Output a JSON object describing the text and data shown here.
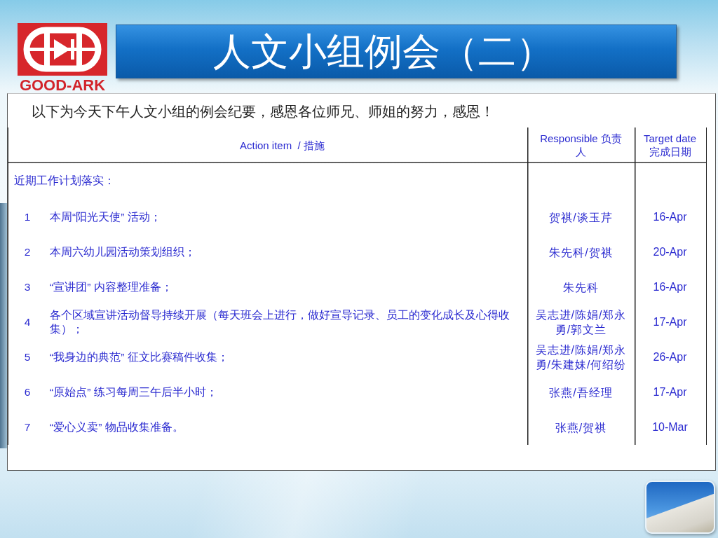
{
  "logo": {
    "wordmark": "GOOD-ARK"
  },
  "title": "人文小组例会（二）",
  "intro": "以下为今天下午人文小组的例会纪要，感恩各位师兄、师姐的努力，感恩！",
  "table": {
    "columns": [
      "Action item  / 措施",
      "Responsible 负责人",
      "Target date 完成日期"
    ],
    "section": "近期工作计划落实：",
    "rows": [
      {
        "number": "1",
        "action": "本周“阳光天使” 活动；",
        "responsible": "贺祺/谈玉芹",
        "target_date": "16-Apr"
      },
      {
        "number": "2",
        "action": "本周六幼儿园活动策划组织；",
        "responsible": "朱先科/贺祺",
        "target_date": "20-Apr"
      },
      {
        "number": "3",
        "action": "“宣讲团” 内容整理准备；",
        "responsible": "朱先科",
        "target_date": "16-Apr"
      },
      {
        "number": "4",
        "action": "各个区域宣讲活动督导持续开展（每天班会上进行，做好宣导记录、员工的变化成长及心得收集）；",
        "responsible": "吴志进/陈娟/郑永勇/郭文兰",
        "target_date": "17-Apr"
      },
      {
        "number": "5",
        "action": "“我身边的典范” 征文比赛稿件收集；",
        "responsible": "吴志进/陈娟/郑永勇/朱建妹/何绍纷",
        "target_date": "26-Apr"
      },
      {
        "number": "6",
        "action": "“原始点” 练习每周三午后半小时；",
        "responsible": "张燕/吾经理",
        "target_date": "17-Apr"
      },
      {
        "number": "7",
        "action": "“爱心义卖” 物品收集准备。",
        "responsible": "张燕/贺祺",
        "target_date": "10-Mar"
      }
    ]
  }
}
